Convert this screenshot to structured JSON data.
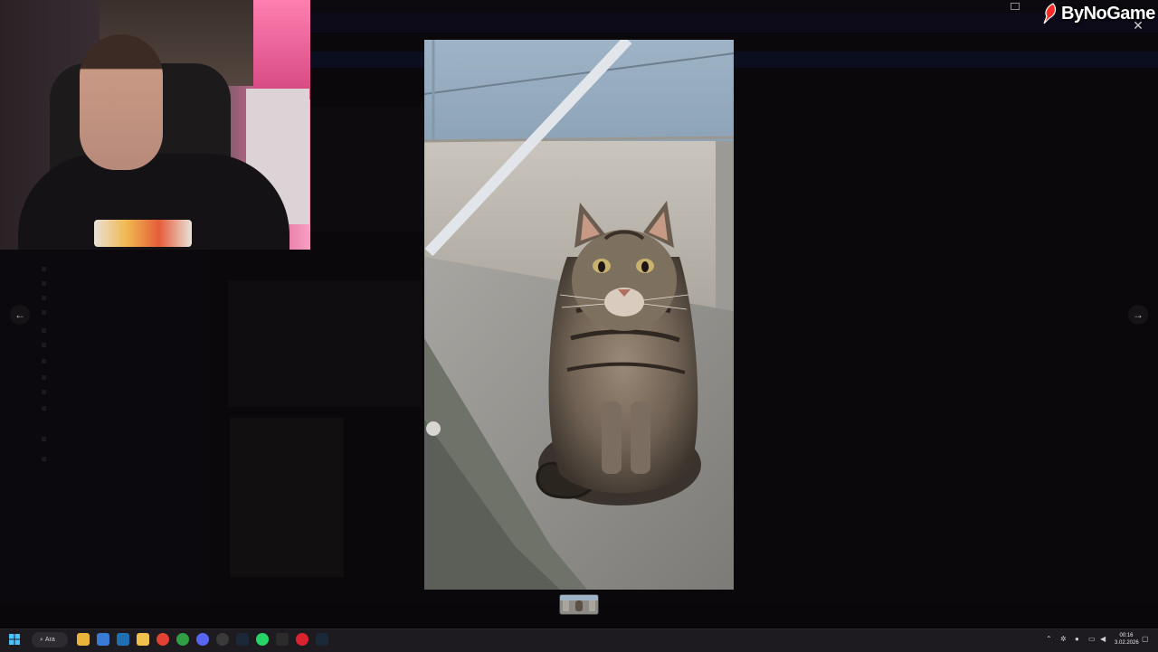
{
  "stream": {
    "brand_name": "ByNoGame",
    "brand_color": "#ff2a2a"
  },
  "background_app": {
    "title": "",
    "channels": [
      "",
      "",
      "",
      "",
      "",
      "",
      "",
      "",
      "",
      "",
      "",
      ""
    ]
  },
  "viewer": {
    "close_icon": "close-icon",
    "prev_icon": "arrow-left-icon",
    "next_icon": "arrow-right-icon",
    "prev_glyph": "←",
    "next_glyph": "→",
    "close_glyph": "✕"
  },
  "taskbar": {
    "search_label": "Ara",
    "time": "00:16",
    "date": "3.02.2026",
    "apps": [
      "windows-start-icon",
      "search-icon",
      "file-explorer-icon",
      "store-icon",
      "vscode-icon",
      "notes-icon",
      "chrome-icon",
      "xbox-icon",
      "discord-icon",
      "chatgpt-icon",
      "steam-icon",
      "whatsapp-icon",
      "terminal-icon",
      "record-icon",
      "steam-alt-icon"
    ]
  }
}
